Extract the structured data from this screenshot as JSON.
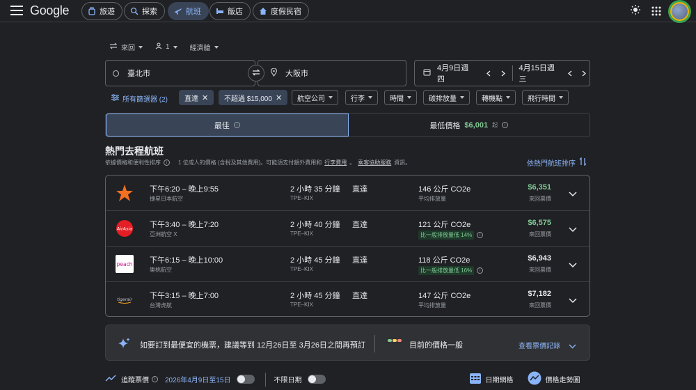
{
  "header": {
    "logo": "Google",
    "tabs": [
      {
        "label": "旅遊",
        "icon": "suitcase-icon"
      },
      {
        "label": "探索",
        "icon": "explore-icon"
      },
      {
        "label": "航班",
        "icon": "airplane-icon",
        "active": true
      },
      {
        "label": "飯店",
        "icon": "bed-icon"
      },
      {
        "label": "度假民宿",
        "icon": "house-icon"
      }
    ]
  },
  "search": {
    "trip_type": "來回",
    "passengers": "1",
    "cabin": "經濟艙",
    "origin": "臺北市",
    "destination": "大阪市",
    "depart_date": "4月9日週四",
    "return_date": "4月15日週三"
  },
  "filters": {
    "all_filters": "所有篩選器 (2)",
    "chips": [
      {
        "label": "直達",
        "selected": true
      },
      {
        "label": "不超過 $15,000",
        "selected": true
      },
      {
        "label": "航空公司"
      },
      {
        "label": "行李"
      },
      {
        "label": "時間"
      },
      {
        "label": "碳排放量"
      },
      {
        "label": "轉機點"
      },
      {
        "label": "飛行時間"
      }
    ]
  },
  "sort": {
    "best": "最佳",
    "cheapest_label": "最低價格",
    "cheapest_price": "$6,001",
    "cheapest_suffix": "起"
  },
  "section": {
    "title": "熱門去程航班",
    "sub_sort": "依據價格和便利性排序",
    "sub_note1": "1 位成人的價格 (含稅及其他費用)。可能須支付額外費用和",
    "sub_link1": "行李費用",
    "sub_dot": "。",
    "sub_link2": "乘客協助服務",
    "sub_note2": "資訊。",
    "sort_by": "依熱門航班排序"
  },
  "flights": [
    {
      "times": "下午6:20 – 晚上9:55",
      "airline": "捷星日本航空",
      "duration": "2 小時 35 分鐘",
      "route": "TPE–KIX",
      "stops": "直達",
      "co2": "146 公斤 CO2e",
      "emissions": "平均排放量",
      "badge": "",
      "price": "$6,351",
      "price_green": true,
      "price_type": "來回票價",
      "logo": "jetstar"
    },
    {
      "times": "下午3:40 – 晚上7:20",
      "airline": "亞洲航空 X",
      "duration": "2 小時 40 分鐘",
      "route": "TPE–KIX",
      "stops": "直達",
      "co2": "121 公斤 CO2e",
      "emissions": "",
      "badge": "比一般排放量低 14%",
      "price": "$6,575",
      "price_green": true,
      "price_type": "來回票價",
      "logo": "airasia"
    },
    {
      "times": "下午6:15 – 晚上10:00",
      "airline": "樂桃航空",
      "duration": "2 小時 45 分鐘",
      "route": "TPE–KIX",
      "stops": "直達",
      "co2": "118 公斤 CO2e",
      "emissions": "",
      "badge": "比一般排放量低 16%",
      "price": "$6,943",
      "price_green": false,
      "price_type": "來回票價",
      "logo": "peach"
    },
    {
      "times": "下午3:15 – 晚上7:00",
      "airline": "台灣虎航",
      "duration": "2 小時 45 分鐘",
      "route": "TPE–KIX",
      "stops": "直達",
      "co2": "147 公斤 CO2e",
      "emissions": "平均排放量",
      "badge": "",
      "price": "$7,182",
      "price_green": false,
      "price_type": "來回票價",
      "logo": "tigerair"
    }
  ],
  "tip": {
    "message": "如要訂到最便宜的機票，建議等到 12月26日至 3月26日之間再預訂",
    "price_level": "目前的價格一般",
    "history": "查看票價記錄"
  },
  "bottom": {
    "track": "追蹤票價",
    "dates": "2026年4月9日至15日",
    "any_dates": "不限日期",
    "date_grid": "日期網格",
    "price_graph": "價格走勢圖"
  }
}
